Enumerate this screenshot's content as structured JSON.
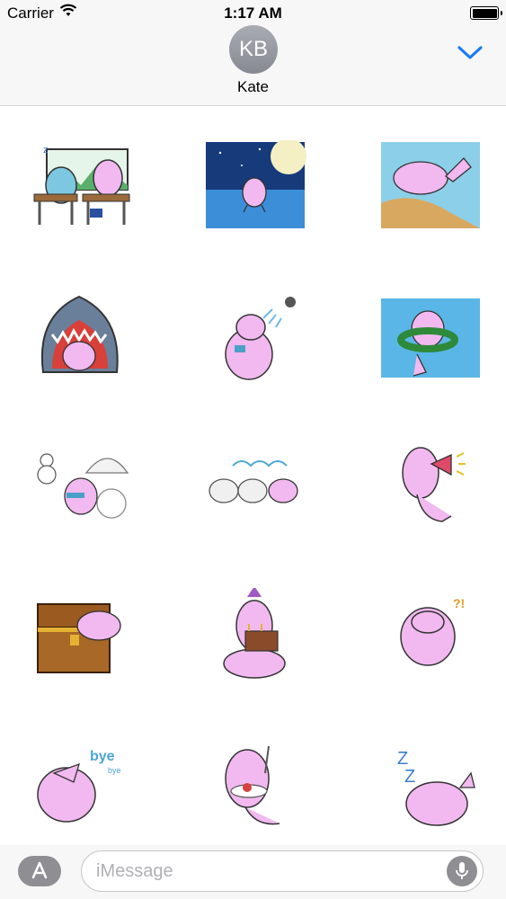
{
  "status_bar": {
    "carrier": "Carrier",
    "time": "1:17 AM",
    "wifi_icon": "wifi-icon",
    "battery_icon": "battery-icon"
  },
  "header": {
    "avatar_initials": "KB",
    "contact_name": "Kate",
    "collapse_icon": "chevron-down-icon"
  },
  "stickers": [
    {
      "name": "sticker-classroom"
    },
    {
      "name": "sticker-night-sea"
    },
    {
      "name": "sticker-beach"
    },
    {
      "name": "sticker-shark"
    },
    {
      "name": "sticker-shower"
    },
    {
      "name": "sticker-swim-ring"
    },
    {
      "name": "sticker-snowman"
    },
    {
      "name": "sticker-three-friends"
    },
    {
      "name": "sticker-megaphone"
    },
    {
      "name": "sticker-treasure-chest"
    },
    {
      "name": "sticker-birthday-cake"
    },
    {
      "name": "sticker-surprised"
    },
    {
      "name": "sticker-bye",
      "text": "bye",
      "subtext": "bye"
    },
    {
      "name": "sticker-eating"
    },
    {
      "name": "sticker-sleeping"
    }
  ],
  "surprised_text": "?!",
  "bye_text": "bye",
  "bye_small_text": "bye",
  "input": {
    "placeholder": "iMessage"
  },
  "colors": {
    "accent": "#1a7cf5",
    "dugong_pink": "#f1b9ef",
    "bar_bg": "#f7f7f7"
  }
}
